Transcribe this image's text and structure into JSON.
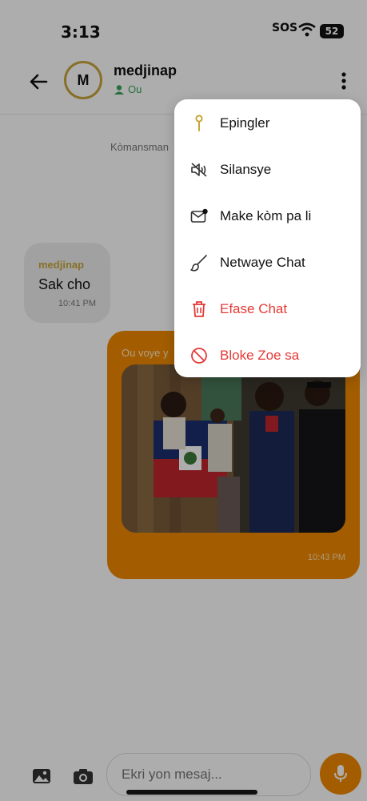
{
  "status_bar": {
    "time": "3:13",
    "sos": "SOS",
    "battery": "52"
  },
  "header": {
    "avatar_initial": "M",
    "name": "medjinap",
    "presence": "Ou"
  },
  "chat": {
    "system_message": "Kòmansman",
    "incoming": {
      "sender": "medjinap",
      "text": "Sak cho",
      "time": "10:41 PM"
    },
    "outgoing": {
      "caption": "Ou voye y",
      "time": "10:43 PM"
    }
  },
  "menu": {
    "items": [
      {
        "label": "Epingler",
        "icon": "pin-icon"
      },
      {
        "label": "Silansye",
        "icon": "mute-icon"
      },
      {
        "label": "Make kòm pa li",
        "icon": "mark-unread-icon"
      },
      {
        "label": "Netwaye Chat",
        "icon": "brush-icon"
      },
      {
        "label": "Efase Chat",
        "icon": "trash-icon",
        "danger": true
      },
      {
        "label": "Bloke Zoe sa",
        "icon": "block-icon",
        "danger": true
      }
    ]
  },
  "composer": {
    "placeholder": "Ekri yon mesaj..."
  },
  "colors": {
    "accent": "#f08a00",
    "gold": "#c8a53a",
    "danger": "#e53935",
    "online": "#3aa55a"
  }
}
